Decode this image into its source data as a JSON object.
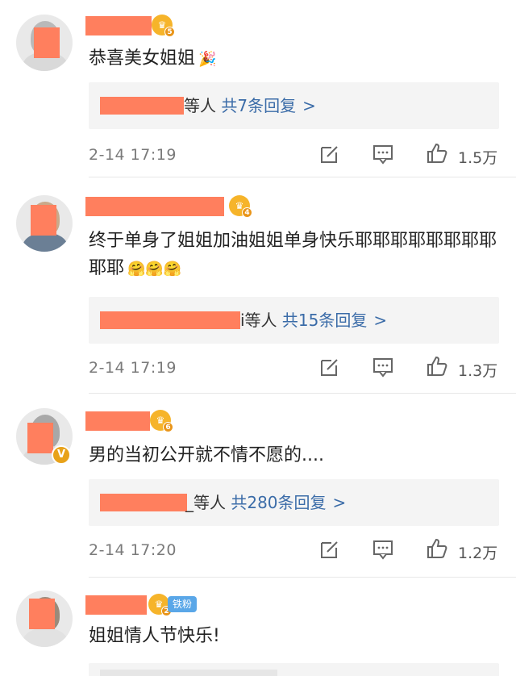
{
  "comments": [
    {
      "text": "恭喜美女姐姐",
      "emoji": "🎉",
      "badge_level": "5",
      "reply": {
        "users_suffix": "等人",
        "count": "共7条回复"
      },
      "time": "2-14 17:19",
      "likes": "1.5万"
    },
    {
      "text": "终于单身了姐姐加油姐姐单身快乐耶耶耶耶耶耶耶耶耶耶",
      "emoji": "🤗🤗🤗",
      "badge_level": "4",
      "reply": {
        "users_suffix": "i等人",
        "count": "共15条回复"
      },
      "time": "2-14 17:19",
      "likes": "1.3万"
    },
    {
      "text": "男的当初公开就不情不愿的....",
      "emoji": "",
      "badge_level": "6",
      "verified": "V",
      "reply": {
        "users_suffix": "_等人",
        "count": "共280条回复"
      },
      "time": "2-14 17:20",
      "likes": "1.2万"
    },
    {
      "text": "姐姐情人节快乐!",
      "emoji": "",
      "badge_level": "2",
      "fan_tag": "铁粉"
    }
  ],
  "ui": {
    "chevron": ">"
  }
}
